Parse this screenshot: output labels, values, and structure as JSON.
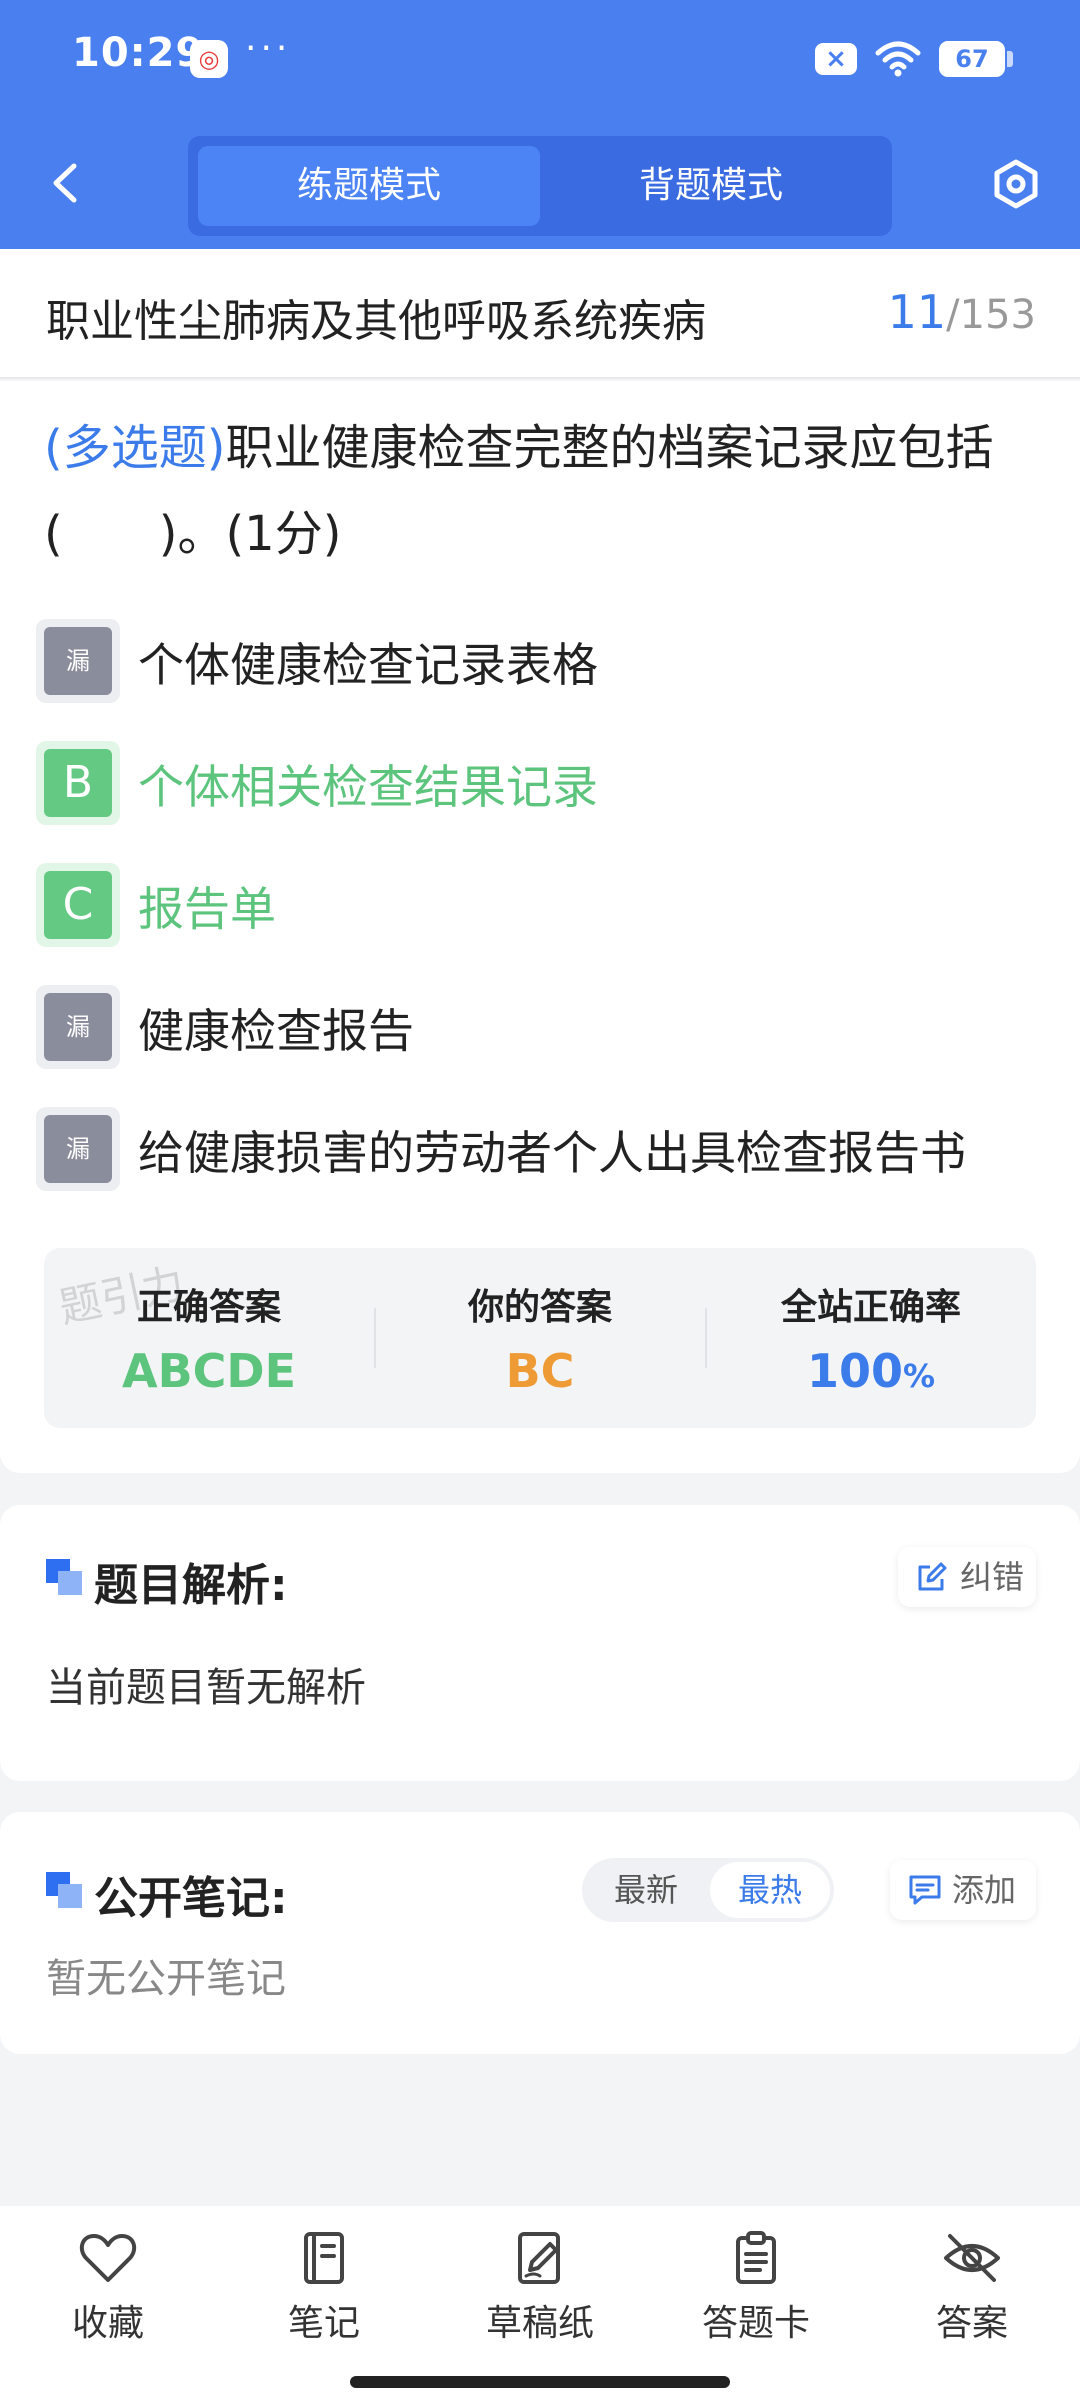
{
  "status_bar": {
    "time": "10:29",
    "app_badge": "◎",
    "dots": "···",
    "battery": "67"
  },
  "nav": {
    "mode_practice": "练题模式",
    "mode_memorize": "背题模式"
  },
  "title_row": {
    "chapter": "职业性尘肺病及其他呼吸系统疾病",
    "current": "11",
    "separator": "/",
    "total": "153"
  },
  "question": {
    "type": "(多选题)",
    "text": "职业健康检查完整的档案记录应包括(　　)。(1分)",
    "options": [
      {
        "badge": "漏",
        "text": "个体健康检查记录表格",
        "state": "missed"
      },
      {
        "badge": "B",
        "text": "个体相关检查结果记录",
        "state": "correct"
      },
      {
        "badge": "C",
        "text": "报告单",
        "state": "correct"
      },
      {
        "badge": "漏",
        "text": "健康检查报告",
        "state": "missed"
      },
      {
        "badge": "漏",
        "text": "给健康损害的劳动者个人出具检查报告书",
        "state": "missed"
      }
    ]
  },
  "stats": {
    "watermark": "题引力",
    "correct_label": "正确答案",
    "correct_value": "ABCDE",
    "yours_label": "你的答案",
    "yours_value": "BC",
    "rate_label": "全站正确率",
    "rate_value": "100",
    "rate_unit": "%"
  },
  "analysis": {
    "title": "题目解析:",
    "report_label": "纠错",
    "body": "当前题目暂无解析"
  },
  "notes": {
    "title": "公开笔记:",
    "sort_latest": "最新",
    "sort_hot": "最热",
    "add_label": "添加",
    "body": "暂无公开笔记"
  },
  "bottom_bar": {
    "favorite": "收藏",
    "notes": "笔记",
    "scratch": "草稿纸",
    "answer_card": "答题卡",
    "answer": "答案"
  },
  "colors": {
    "brand_blue": "#4a7ff0",
    "correct_green": "#5cc47c",
    "your_answer_orange": "#ee9a35",
    "rate_blue": "#3b7bea"
  }
}
